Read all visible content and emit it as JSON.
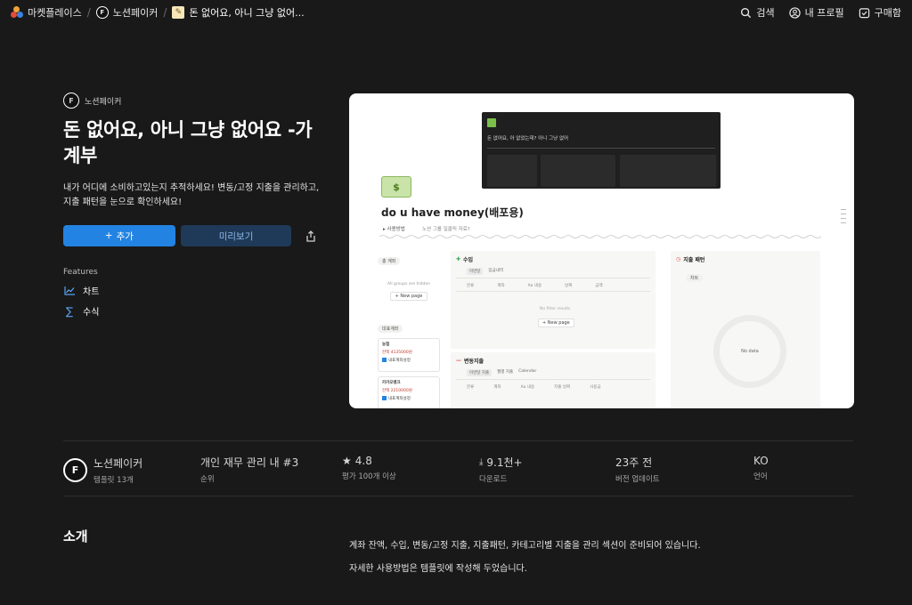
{
  "breadcrumb": {
    "items": [
      {
        "label": "마켓플레이스"
      },
      {
        "label": "노션페이커"
      },
      {
        "label": "돈 없어요, 아니 그냥 없어..."
      }
    ]
  },
  "topnav": {
    "search": "검색",
    "profile": "내 프로필",
    "purchases": "구매함"
  },
  "template": {
    "creator": "노션페이커",
    "title": "돈 없어요, 아니 그냥 없어요 -가계부",
    "description": "내가 어디에 소비하고있는지 추적하세요! 변동/고정 지출을 관리하고, 지출 패턴을 눈으로 확인하세요!",
    "add_button": "추가",
    "preview_button": "미리보기",
    "features_label": "Features",
    "features": [
      {
        "label": "차트",
        "icon": "chart-icon"
      },
      {
        "label": "수식",
        "icon": "sigma-icon"
      }
    ]
  },
  "preview": {
    "mini_title": "돈 없어요, 아 없었는데? 아니 그냥 없어",
    "page_title": "do u have money(배포용)",
    "toggle": "▸ 사용방법",
    "quote": "노션 그룹 일클릭 자료?",
    "left_chip": "총 계좌",
    "hint": "All groups are hidden",
    "new_page": "+ New page",
    "acct_chip": "대표계좌",
    "accounts": [
      {
        "name": "농협",
        "amount": "잔액 4135000원",
        "tag": "내표계좌설정"
      },
      {
        "name": "카카오뱅크",
        "amount": "잔액 2210000원",
        "tag": "내표계좌설정"
      }
    ],
    "income_title": "수입",
    "income_tabs": [
      "이번달",
      "입금내역"
    ],
    "income_cols": [
      "분류",
      "계좌",
      "Aa 내용",
      "날짜",
      "금액"
    ],
    "no_filter": "No filter results",
    "variable_title": "변동지출",
    "variable_tabs": [
      "이번달 지출",
      "월별 지출",
      "Calendar"
    ],
    "variable_cols": [
      "분류",
      "계좌",
      "Aa 내용",
      "지출 날짜",
      "사용금"
    ],
    "pattern_title": "지출 패턴",
    "pattern_chip": "차트",
    "no_data": "No data"
  },
  "stats": {
    "creator": {
      "value": "노션페이커",
      "label": "템플릿 13개"
    },
    "rank": {
      "value": "개인 재무 관리 내 #3",
      "label": "순위"
    },
    "rating": {
      "value": "4.8",
      "label": "평가 100개 이상"
    },
    "downloads": {
      "value": "9.1천+",
      "label": "다운로드"
    },
    "updated": {
      "value": "23주 전",
      "label": "버전 업데이트"
    },
    "language": {
      "value": "KO",
      "label": "언어"
    }
  },
  "intro": {
    "heading": "소개",
    "paragraphs": [
      "계좌 잔액, 수입, 변동/고정 지출, 지출패턴, 카테고리별 지출을 관리 섹션이 준비되어 있습니다.",
      "자세한 사용방법은 템플릿에 작성해 두었습니다."
    ]
  },
  "colors": {
    "background": "#191919",
    "accent": "#2383e2",
    "secondary_button": "#1f3a58"
  }
}
